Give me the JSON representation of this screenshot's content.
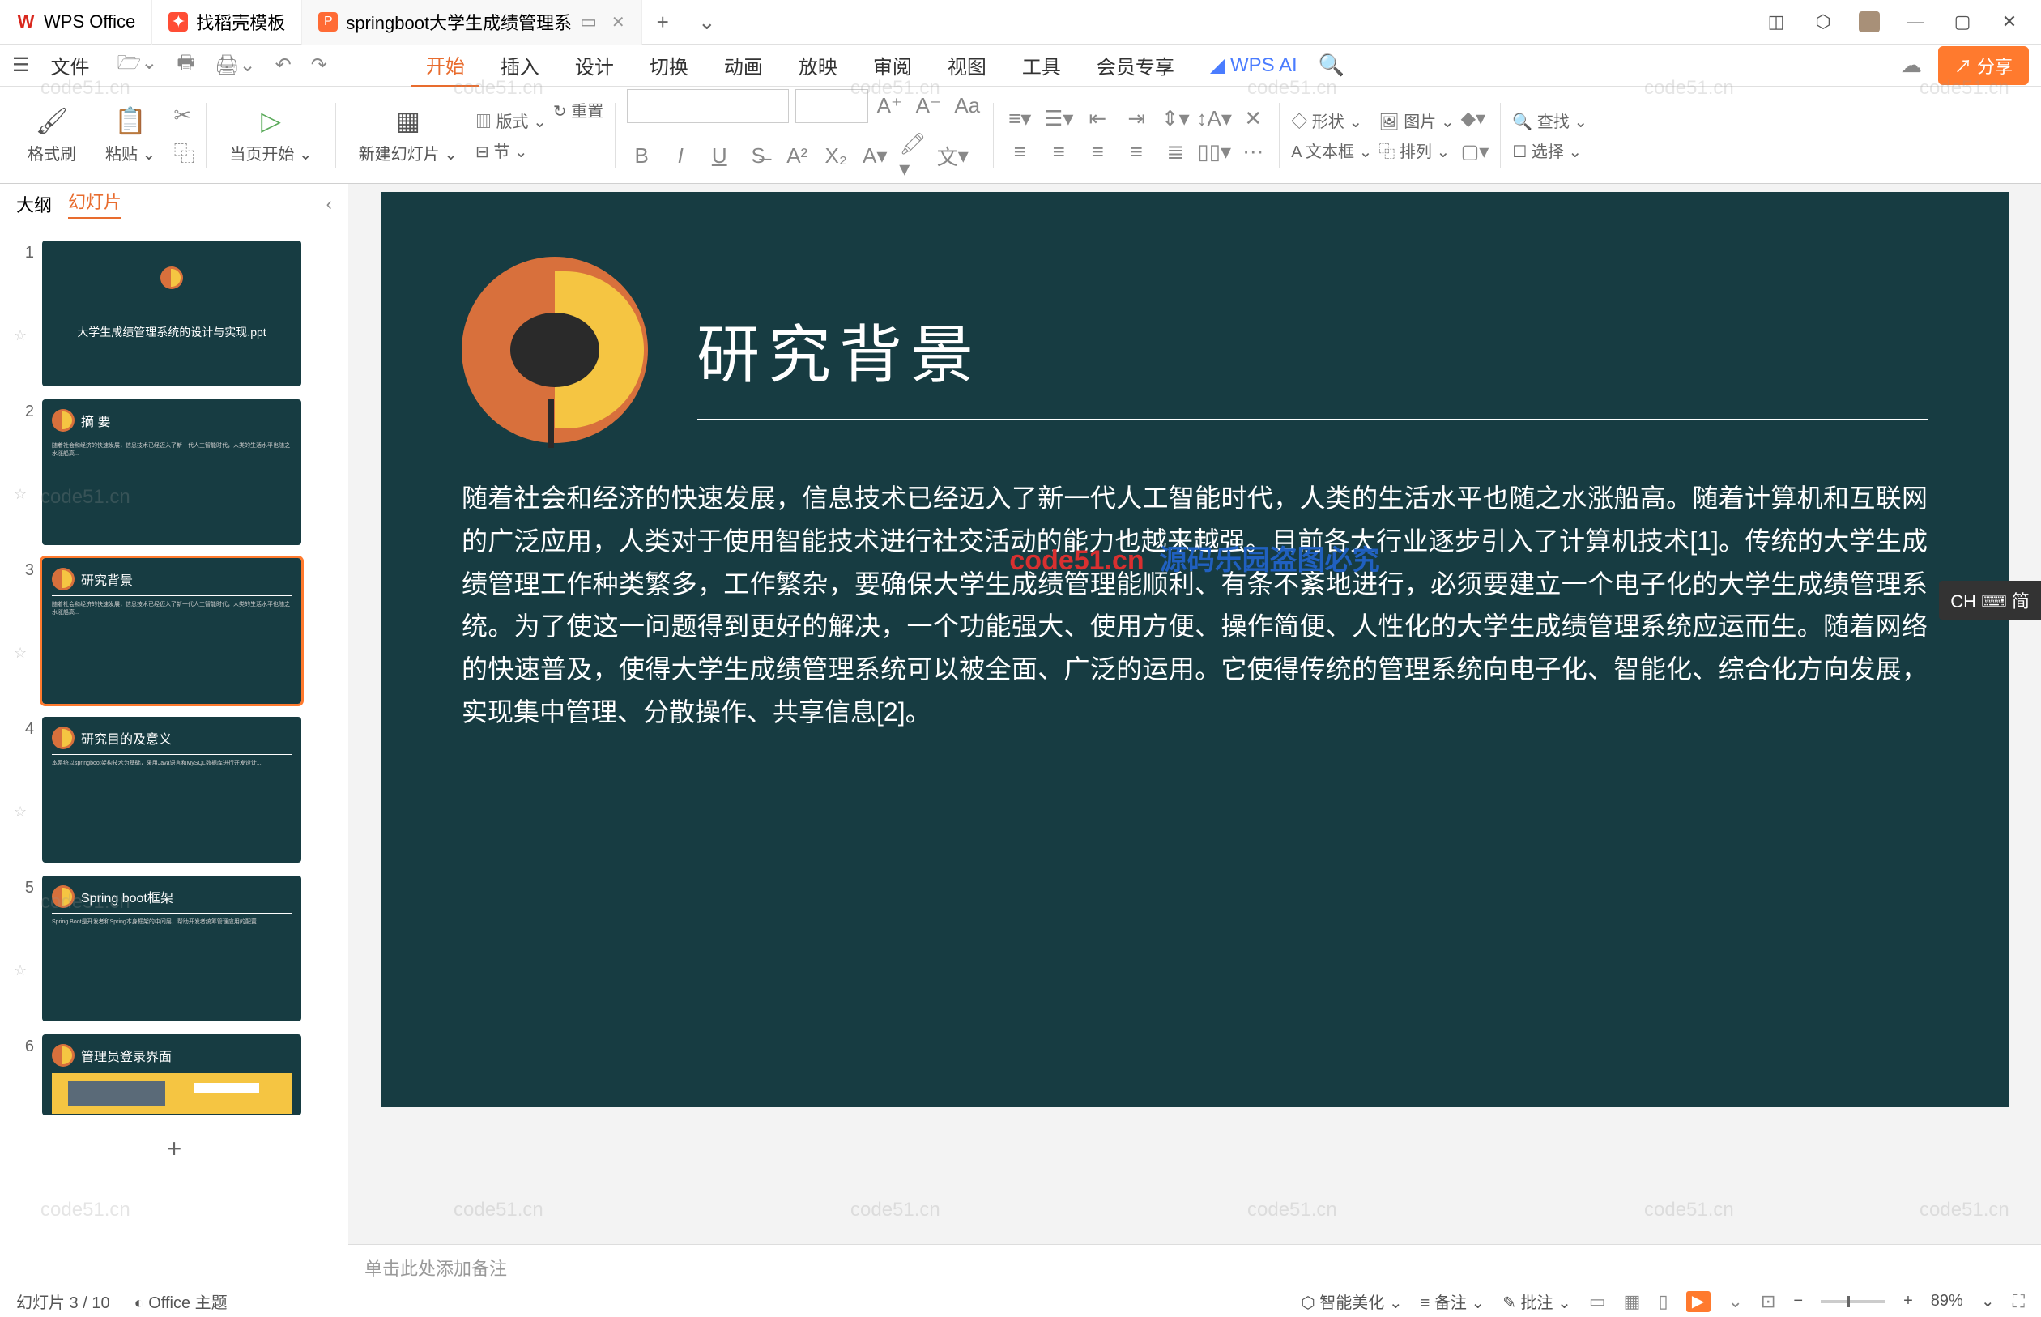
{
  "titlebar": {
    "tabs": [
      {
        "icon_color": "#d9281e",
        "label": "WPS Office"
      },
      {
        "icon_color": "#ff4d35",
        "label": "找稻壳模板"
      },
      {
        "icon_color": "#ff6b35",
        "label": "springboot大学生成绩管理系"
      }
    ],
    "add": "+",
    "dropdown": "⌄"
  },
  "menubar": {
    "file": "文件",
    "items": [
      "开始",
      "插入",
      "设计",
      "切换",
      "动画",
      "放映",
      "审阅",
      "视图",
      "工具",
      "会员专享"
    ],
    "ai": "WPS AI",
    "share": "分享"
  },
  "ribbon": {
    "format_brush": "格式刷",
    "paste": "粘贴",
    "from_current": "当页开始",
    "new_slide": "新建幻灯片",
    "layout": "版式",
    "section": "节",
    "reset": "重置",
    "text_v": "文",
    "shape": "形状",
    "image": "图片",
    "textbox": "文本框",
    "arrange": "排列",
    "find": "查找",
    "select": "选择"
  },
  "side": {
    "tabs": [
      "大纲",
      "幻灯片"
    ],
    "slides": [
      {
        "num": "1",
        "title": "大学生成绩管理系统的设计与实现.ppt"
      },
      {
        "num": "2",
        "title": "摘  要",
        "body": "随着社会和经济的快速发展，信息技术已经迈入了新一代人工智能时代，人类的生活水平也随之水涨船高..."
      },
      {
        "num": "3",
        "title": "研究背景",
        "body": "随着社会和经济的快速发展，信息技术已经迈入了新一代人工智能时代，人类的生活水平也随之水涨船高..."
      },
      {
        "num": "4",
        "title": "研究目的及意义",
        "body": "本系统以springboot架构技术为基础，采用Java语言和MySQL数据库进行开发设计..."
      },
      {
        "num": "5",
        "title": "Spring boot框架",
        "body": "Spring Boot是开发者和Spring本身框架的中间层，帮助开发者统筹管理应用的配置..."
      },
      {
        "num": "6",
        "title": "管理员登录界面"
      }
    ],
    "add": "+"
  },
  "slide": {
    "title": "研究背景",
    "body": "随着社会和经济的快速发展，信息技术已经迈入了新一代人工智能时代，人类的生活水平也随之水涨船高。随着计算机和互联网的广泛应用，人类对于使用智能技术进行社交活动的能力也越来越强。目前各大行业逐步引入了计算机技术[1]。传统的大学生成绩管理工作种类繁多，工作繁杂，要确保大学生成绩管理能顺利、有条不紊地进行，必须要建立一个电子化的大学生成绩管理系统。为了使这一问题得到更好的解决，一个功能强大、使用方便、操作简便、人性化的大学生成绩管理系统应运而生。随着网络的快速普及，使得大学生成绩管理系统可以被全面、广泛的运用。它使得传统的管理系统向电子化、智能化、综合化方向发展，实现集中管理、分散操作、共享信息[2]。",
    "overlay_red": "code51.cn",
    "overlay_blue": "源码乐园盗图必究"
  },
  "ime": "CH ⌨ 简",
  "notes": "单击此处添加备注",
  "status": {
    "slide_pos": "幻灯片 3 / 10",
    "theme": "Office 主题",
    "beautify": "智能美化",
    "remark": "备注",
    "review": "批注",
    "zoom": "89%"
  },
  "watermark": "code51.cn"
}
